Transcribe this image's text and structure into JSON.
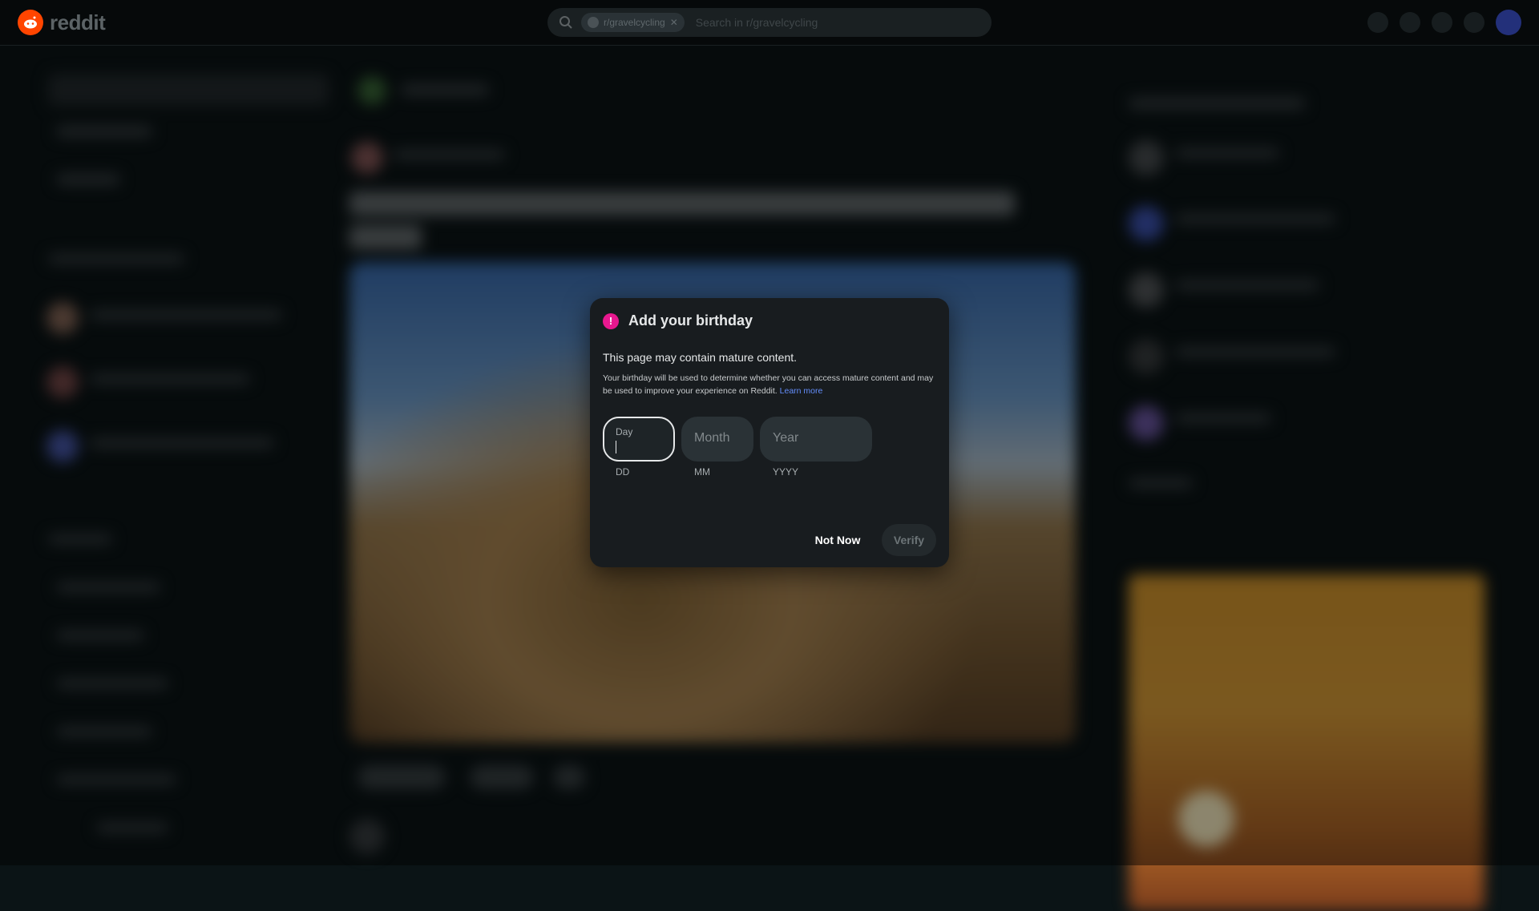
{
  "topbar": {
    "logo_text": "reddit",
    "search": {
      "community_chip": "r/gravelcycling",
      "placeholder": "Search in r/gravelcycling"
    },
    "icons": [
      "ads-icon",
      "chat-icon",
      "create-icon",
      "notifications-icon",
      "avatar"
    ]
  },
  "modal": {
    "title": "Add your birthday",
    "mature_notice": "This page may contain mature content.",
    "explanation": "Your birthday will be used to determine whether you can access mature content and may be used to improve your experience on Reddit.",
    "learn_more": "Learn more",
    "fields": {
      "day": {
        "label": "Day",
        "hint": "DD",
        "value": ""
      },
      "month": {
        "placeholder": "Month",
        "hint": "MM",
        "value": ""
      },
      "year": {
        "placeholder": "Year",
        "hint": "YYYY",
        "value": ""
      }
    },
    "buttons": {
      "not_now": "Not Now",
      "verify": "Verify"
    }
  },
  "colors": {
    "accent_pink": "#e8188f",
    "link_blue": "#648efc",
    "reddit_orange": "#ff4500"
  }
}
